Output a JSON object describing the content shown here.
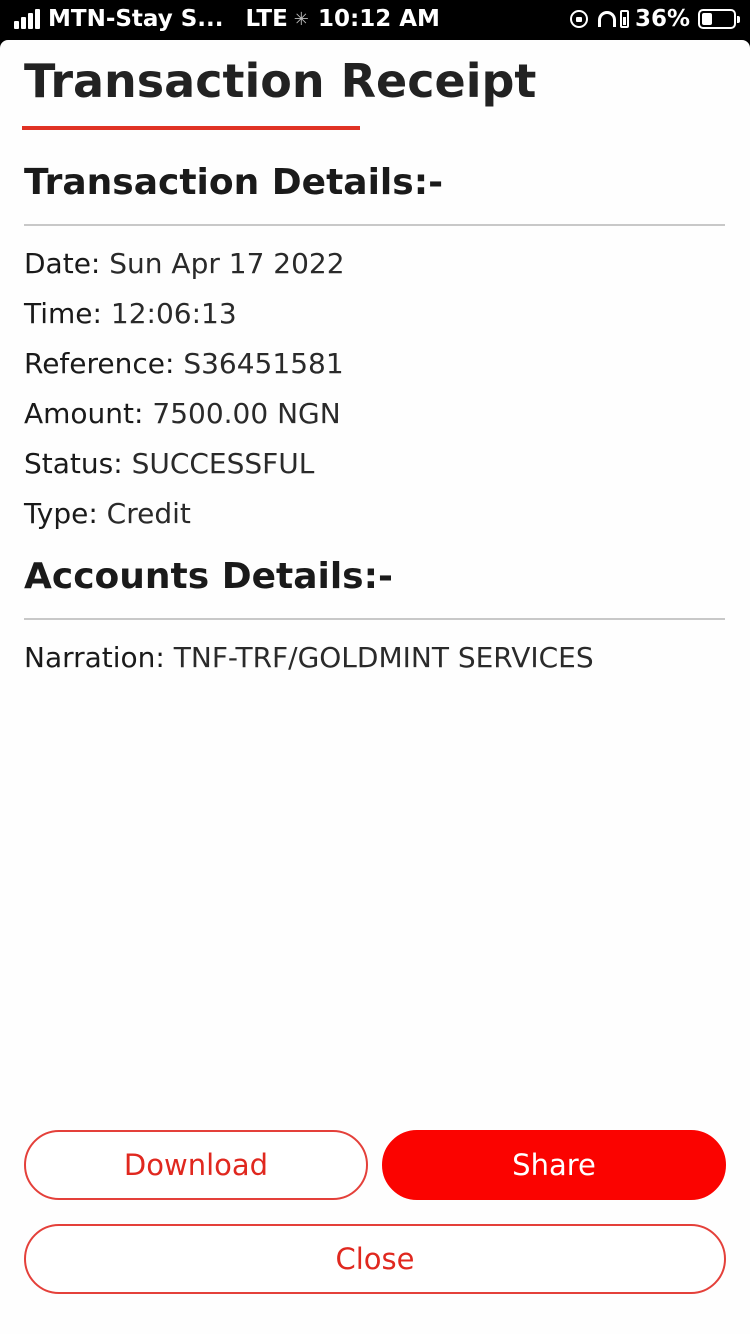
{
  "status_bar": {
    "carrier": "MTN-Stay S...",
    "network": "LTE",
    "activity_icon": "loading-spinner-icon",
    "time": "10:12 AM",
    "battery_percent": "36%",
    "battery_level": 0.36
  },
  "receipt": {
    "title": "Transaction Receipt",
    "accent_color": "#e03224",
    "transaction_heading": "Transaction Details:-",
    "transaction_details": [
      {
        "label": "Date:",
        "value": "Sun Apr 17 2022"
      },
      {
        "label": "Time:",
        "value": "12:06:13"
      },
      {
        "label": "Reference:",
        "value": "S36451581"
      },
      {
        "label": "Amount:",
        "value": "7500.00 NGN"
      },
      {
        "label": "Status:",
        "value": "SUCCESSFUL"
      },
      {
        "label": "Type:",
        "value": "Credit"
      }
    ],
    "accounts_heading": "Accounts Details:-",
    "account_details": [
      {
        "label": "Narration:",
        "value": "TNF-TRF/GOLDMINT SERVICES"
      }
    ]
  },
  "actions": {
    "download_label": "Download",
    "share_label": "Share",
    "close_label": "Close",
    "primary_color": "#fb0300"
  }
}
